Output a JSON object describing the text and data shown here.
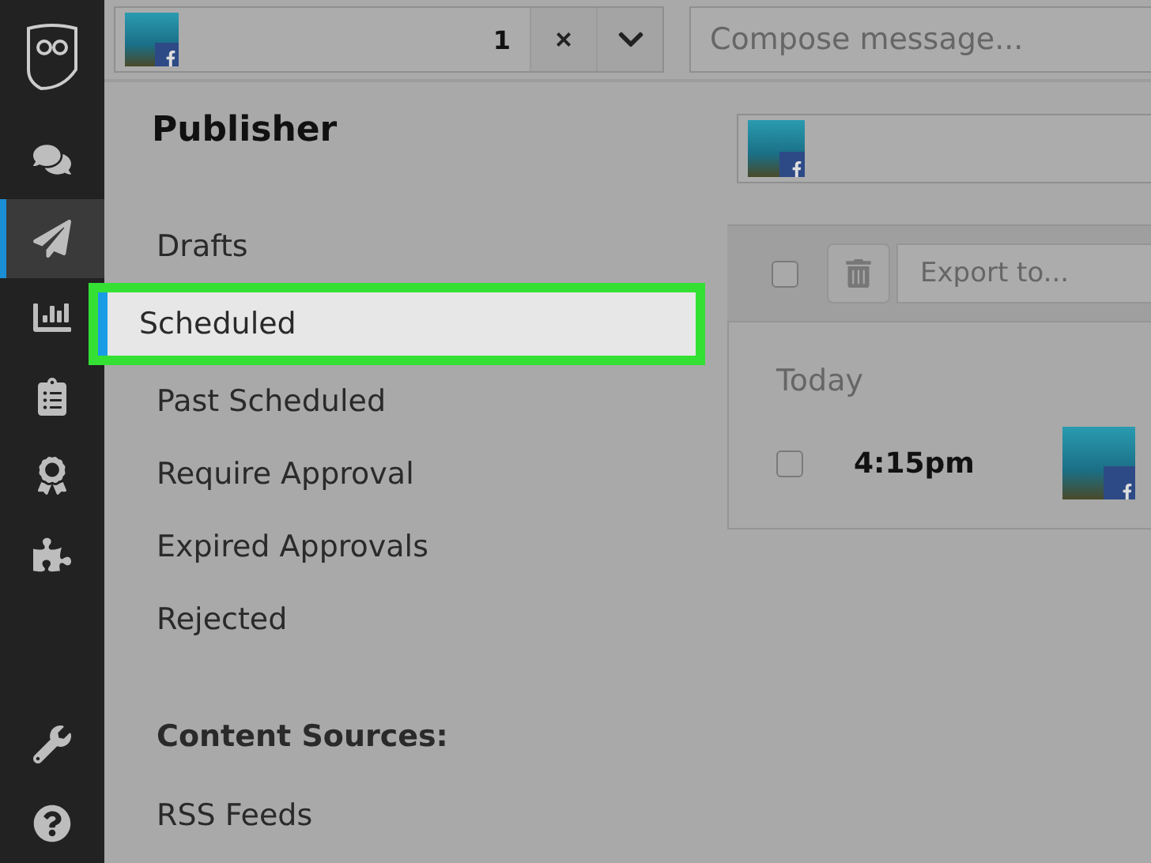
{
  "rail": {
    "items": [
      {
        "kind": "chat",
        "selected": false
      },
      {
        "kind": "send",
        "selected": true
      },
      {
        "kind": "chart",
        "selected": false
      },
      {
        "kind": "clipboard",
        "selected": false
      },
      {
        "kind": "badge",
        "selected": false
      },
      {
        "kind": "puzzle",
        "selected": false
      }
    ],
    "footer": [
      {
        "kind": "wrench"
      },
      {
        "kind": "help"
      }
    ]
  },
  "top_bar": {
    "profile_count": "1",
    "clear_label": "×",
    "compose": {
      "placeholder": "Compose message..."
    }
  },
  "publisher": {
    "title": "Publisher",
    "menu": [
      {
        "label": "Drafts",
        "selected": false
      },
      {
        "label": "Scheduled",
        "selected": true
      },
      {
        "label": "Past Scheduled",
        "selected": false
      },
      {
        "label": "Require Approval",
        "selected": false
      },
      {
        "label": "Expired Approvals",
        "selected": false
      },
      {
        "label": "Rejected",
        "selected": false
      }
    ],
    "section": "Content Sources:",
    "section_items": [
      "RSS Feeds"
    ]
  },
  "messages": {
    "toolbar": {
      "select_all": {
        "checked": false
      },
      "export": {
        "placeholder": "Export to..."
      }
    },
    "groups": [
      {
        "label": "Today",
        "rows": [
          {
            "time": "4:15pm",
            "checked": false
          }
        ]
      }
    ]
  }
}
